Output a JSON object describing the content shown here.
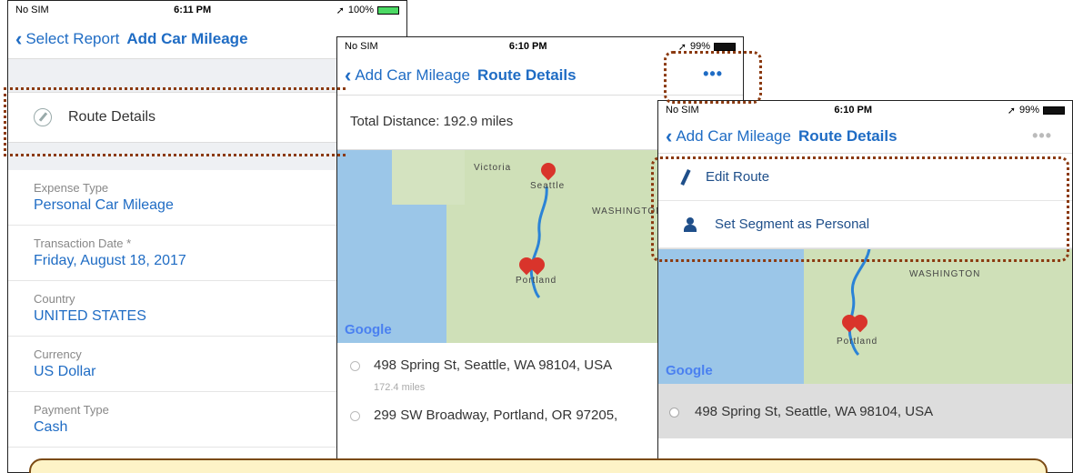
{
  "screen1": {
    "status": {
      "carrier": "No SIM",
      "time": "6:11 PM",
      "battery": "100%",
      "battery_level": 1.0
    },
    "nav": {
      "back_label": "Select Report",
      "title": "Add Car Mileage"
    },
    "route_label": "Route Details",
    "fields": [
      {
        "label": "Expense Type",
        "value": "Personal Car Mileage"
      },
      {
        "label": "Transaction Date *",
        "value": "Friday, August 18, 2017"
      },
      {
        "label": "Country",
        "value": "UNITED STATES"
      },
      {
        "label": "Currency",
        "value": "US Dollar"
      },
      {
        "label": "Payment Type",
        "value": "Cash"
      }
    ]
  },
  "screen2": {
    "status": {
      "carrier": "No SIM",
      "time": "6:10 PM",
      "battery": "99%",
      "battery_level": 0.99
    },
    "nav": {
      "back_label": "Add Car Mileage",
      "title": "Route Details",
      "more_icon": "ellipsis-icon"
    },
    "total_distance": "Total Distance: 192.9 miles",
    "map": {
      "places": [
        "Victoria",
        "Seattle",
        "WASHINGTON",
        "Portland"
      ],
      "attribution": "Google"
    },
    "stops": [
      {
        "address": "498 Spring St, Seattle, WA 98104, USA",
        "miles": "172.4 miles"
      },
      {
        "address": "299 SW Broadway, Portland, OR 97205,"
      }
    ]
  },
  "screen3": {
    "status": {
      "carrier": "No SIM",
      "time": "6:10 PM",
      "battery": "99%",
      "battery_level": 0.99
    },
    "nav": {
      "back_label": "Add Car Mileage",
      "title": "Route Details"
    },
    "menu": [
      {
        "label": "Edit Route",
        "icon": "pencil-icon"
      },
      {
        "label": "Set Segment as Personal",
        "icon": "person-icon"
      }
    ],
    "map": {
      "places": [
        "WASHINGTON",
        "Portland"
      ],
      "attribution": "Google"
    },
    "stop_address": "498 Spring St, Seattle, WA 98104, USA"
  },
  "colors": {
    "accent": "#1f6cc4",
    "highlight": "#8b3a10",
    "note_bg": "#fdf3c7"
  }
}
